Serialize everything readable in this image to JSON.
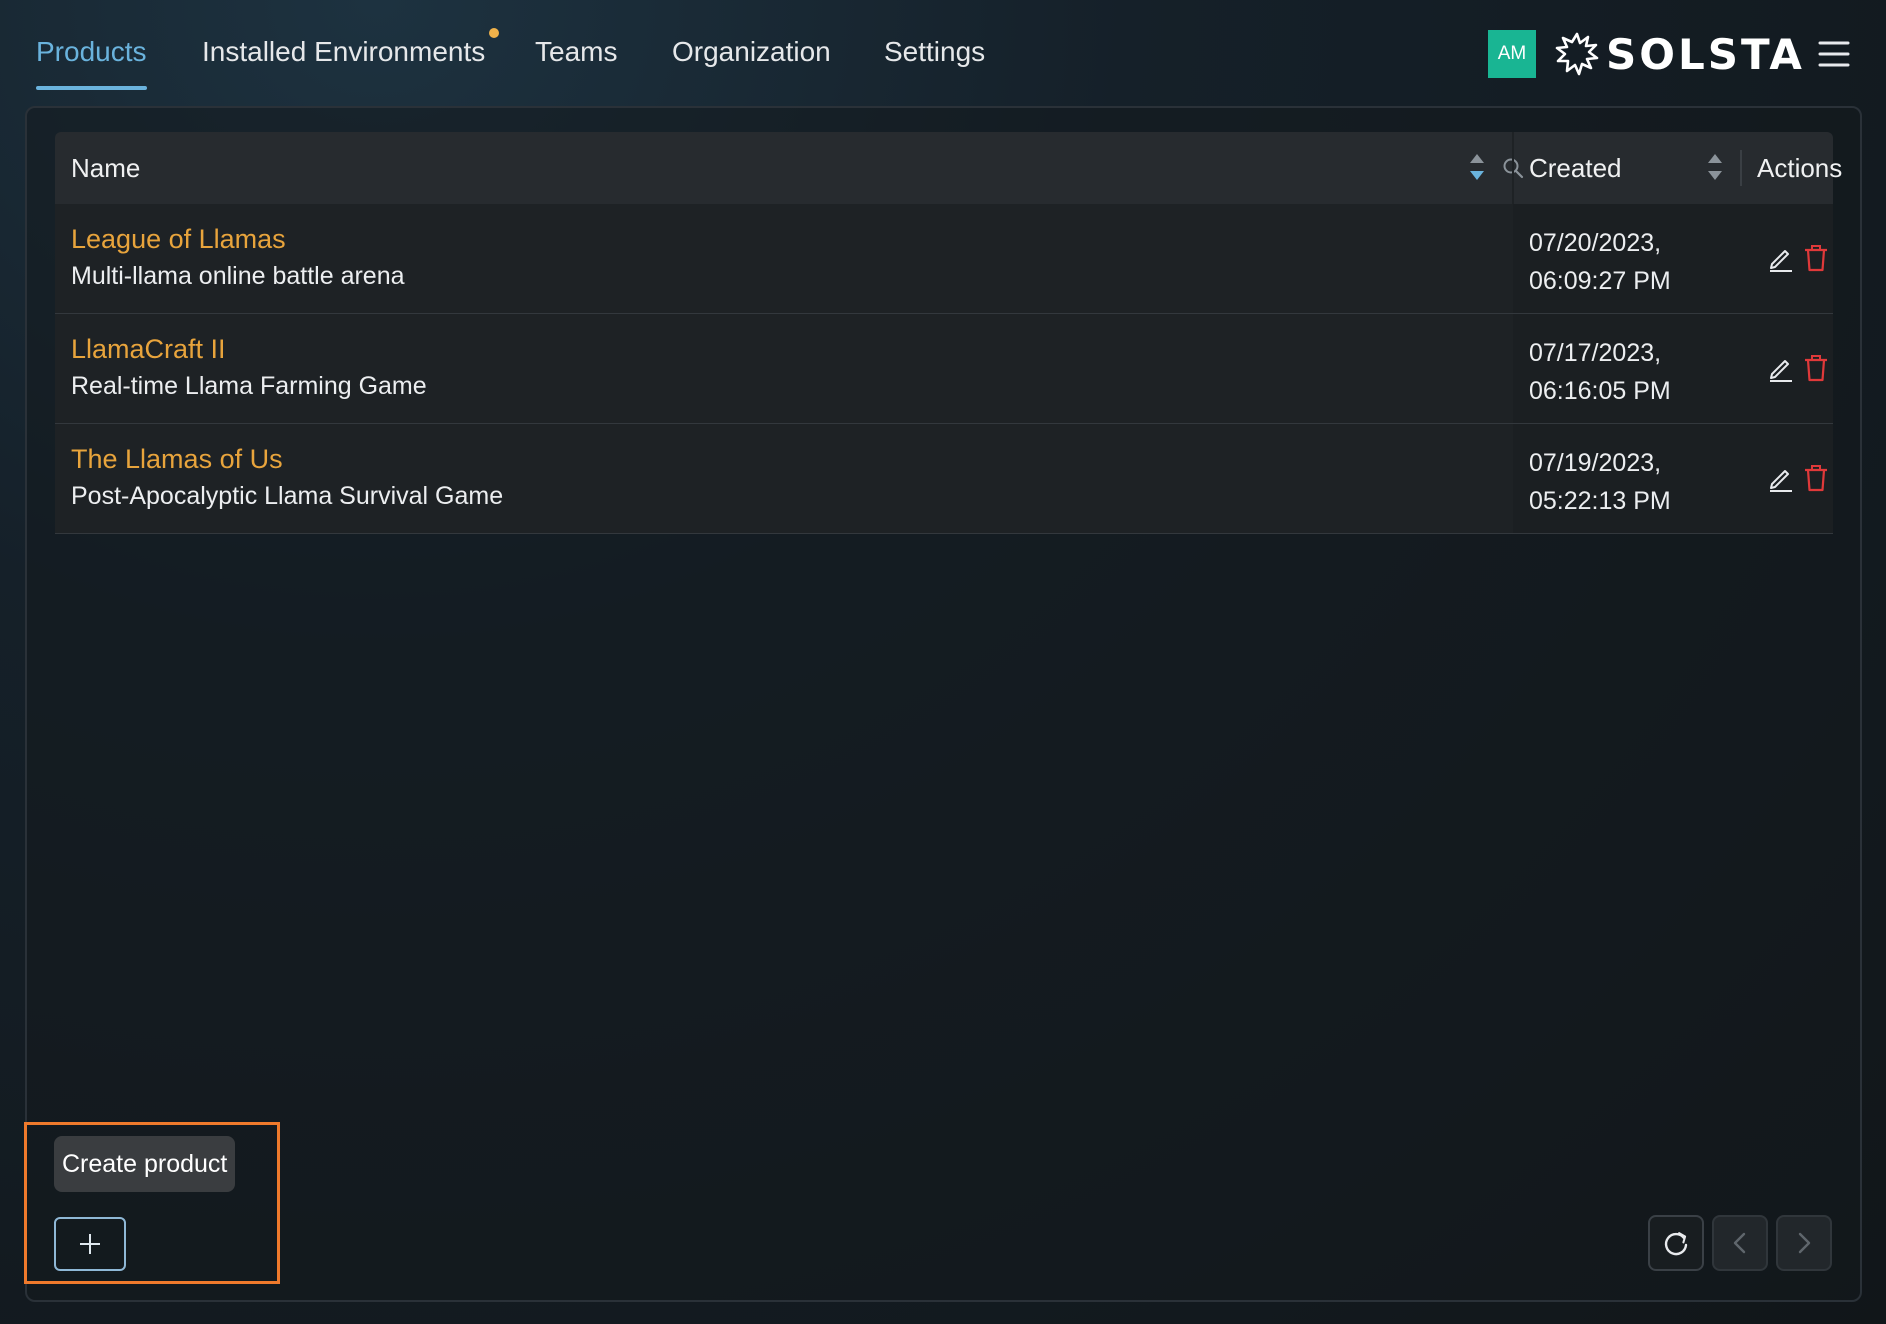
{
  "nav": {
    "tabs": [
      {
        "label": "Products",
        "active": true
      },
      {
        "label": "Installed Environments",
        "badge": true
      },
      {
        "label": "Teams"
      },
      {
        "label": "Organization"
      },
      {
        "label": "Settings"
      }
    ],
    "avatar_initials": "AM",
    "logo_text": "SOLSTA",
    "menu_icon": "hamburger-menu-icon"
  },
  "table": {
    "columns": {
      "name": "Name",
      "created": "Created",
      "actions": "Actions"
    },
    "rows": [
      {
        "name": "League of Llamas",
        "description": "Multi-llama online battle arena",
        "created": "07/20/2023,\n06:09:27 PM"
      },
      {
        "name": "LlamaCraft II",
        "description": "Real-time Llama Farming Game",
        "created": "07/17/2023,\n06:16:05 PM"
      },
      {
        "name": "The Llamas of Us",
        "description": "Post-Apocalyptic Llama Survival Game",
        "created": "07/19/2023,\n05:22:13 PM"
      }
    ]
  },
  "footer": {
    "tooltip": "Create product",
    "add_icon": "plus-icon",
    "refresh_icon": "refresh-icon",
    "prev_icon": "chevron-left-icon",
    "next_icon": "chevron-right-icon"
  },
  "colors": {
    "accent": "#6ab3dd",
    "product_name": "#e8a43c",
    "avatar": "#19b593",
    "delete": "#e0393a",
    "highlight": "#ef7a2c",
    "badge_dot": "#f0b24a"
  }
}
